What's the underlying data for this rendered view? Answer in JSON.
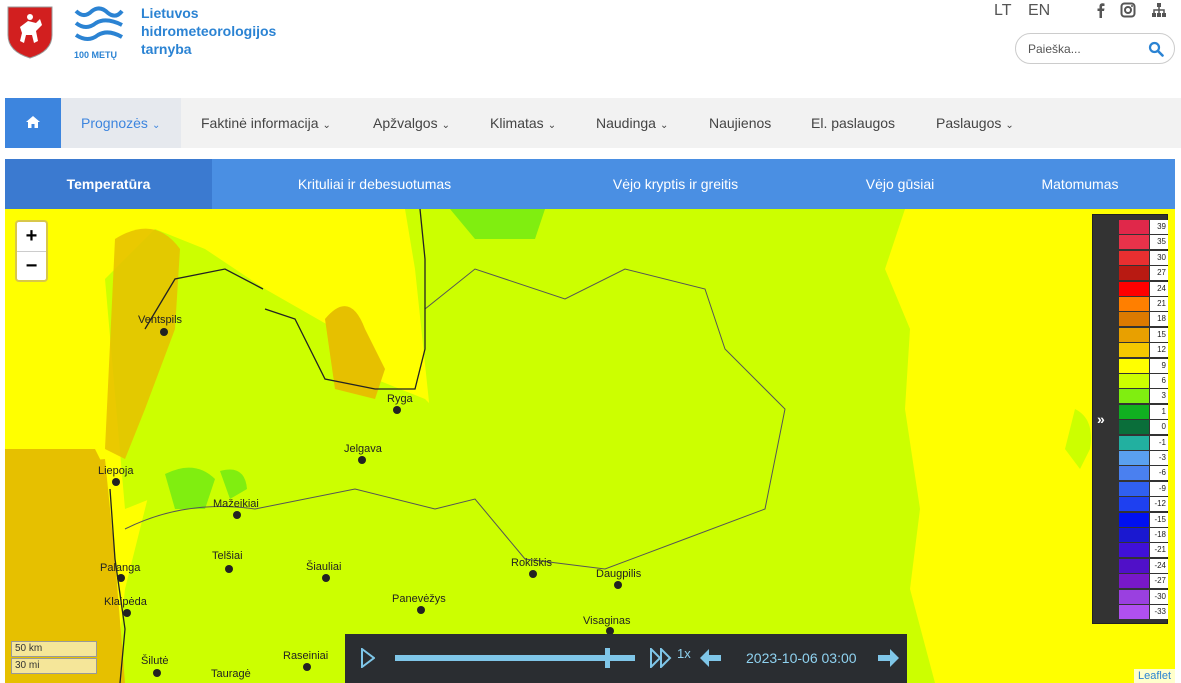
{
  "header": {
    "brand_line1": "Lietuvos",
    "brand_line2": "hidrometeorologijos",
    "brand_line3": "tarnyba",
    "logo_caption": "100 METŲ",
    "lang_lt": "LT",
    "lang_en": "EN",
    "search_placeholder": "Paieška..."
  },
  "nav": {
    "items": [
      "Prognozės",
      "Faktinė informacija",
      "Apžvalgos",
      "Klimatas",
      "Naudinga",
      "Naujienos",
      "El. paslaugos",
      "Paslaugos"
    ]
  },
  "tabs": [
    "Temperatūra",
    "Krituliai ir debesuotumas",
    "Vėjo kryptis ir greitis",
    "Vėjo gūsiai",
    "Matomumas"
  ],
  "map": {
    "zoom_in": "+",
    "zoom_out": "−",
    "scale_km": "50 km",
    "scale_mi": "30 mi",
    "attribution": "Leaflet",
    "cities": [
      "Ventspils",
      "Ryga",
      "Jelgava",
      "Liepoja",
      "Mažeikiai",
      "Telšiai",
      "Šiauliai",
      "Palanga",
      "Klaipėda",
      "Panevėžys",
      "Rokiškis",
      "Daugpilis",
      "Visaginas",
      "Raseiniai",
      "Šilutė",
      "Tauragė"
    ],
    "legend": {
      "values": [
        "39",
        "35",
        "30",
        "27",
        "24",
        "21",
        "18",
        "15",
        "12",
        "9",
        "6",
        "3",
        "1",
        "0",
        "-1",
        "-3",
        "-6",
        "-9",
        "-12",
        "-15",
        "-18",
        "-21",
        "-24",
        "-27",
        "-30",
        "-33"
      ],
      "colors": [
        "#e0284a",
        "#e8324a",
        "#e82f30",
        "#b81a12",
        "#ff0000",
        "#ff7f00",
        "#dc7a00",
        "#e8a000",
        "#f5c800",
        "#ffff00",
        "#ccff00",
        "#80ee10",
        "#10b020",
        "#0a6e3a",
        "#22b0a0",
        "#5aa0f0",
        "#4a80f0",
        "#3060f0",
        "#1e40f0",
        "#0010f0",
        "#1a18d0",
        "#4010d8",
        "#5010c8",
        "#7818c8",
        "#9a40e0",
        "#b050f0"
      ]
    },
    "player": {
      "speed": "1x",
      "time": "2023-10-06 03:00"
    }
  }
}
